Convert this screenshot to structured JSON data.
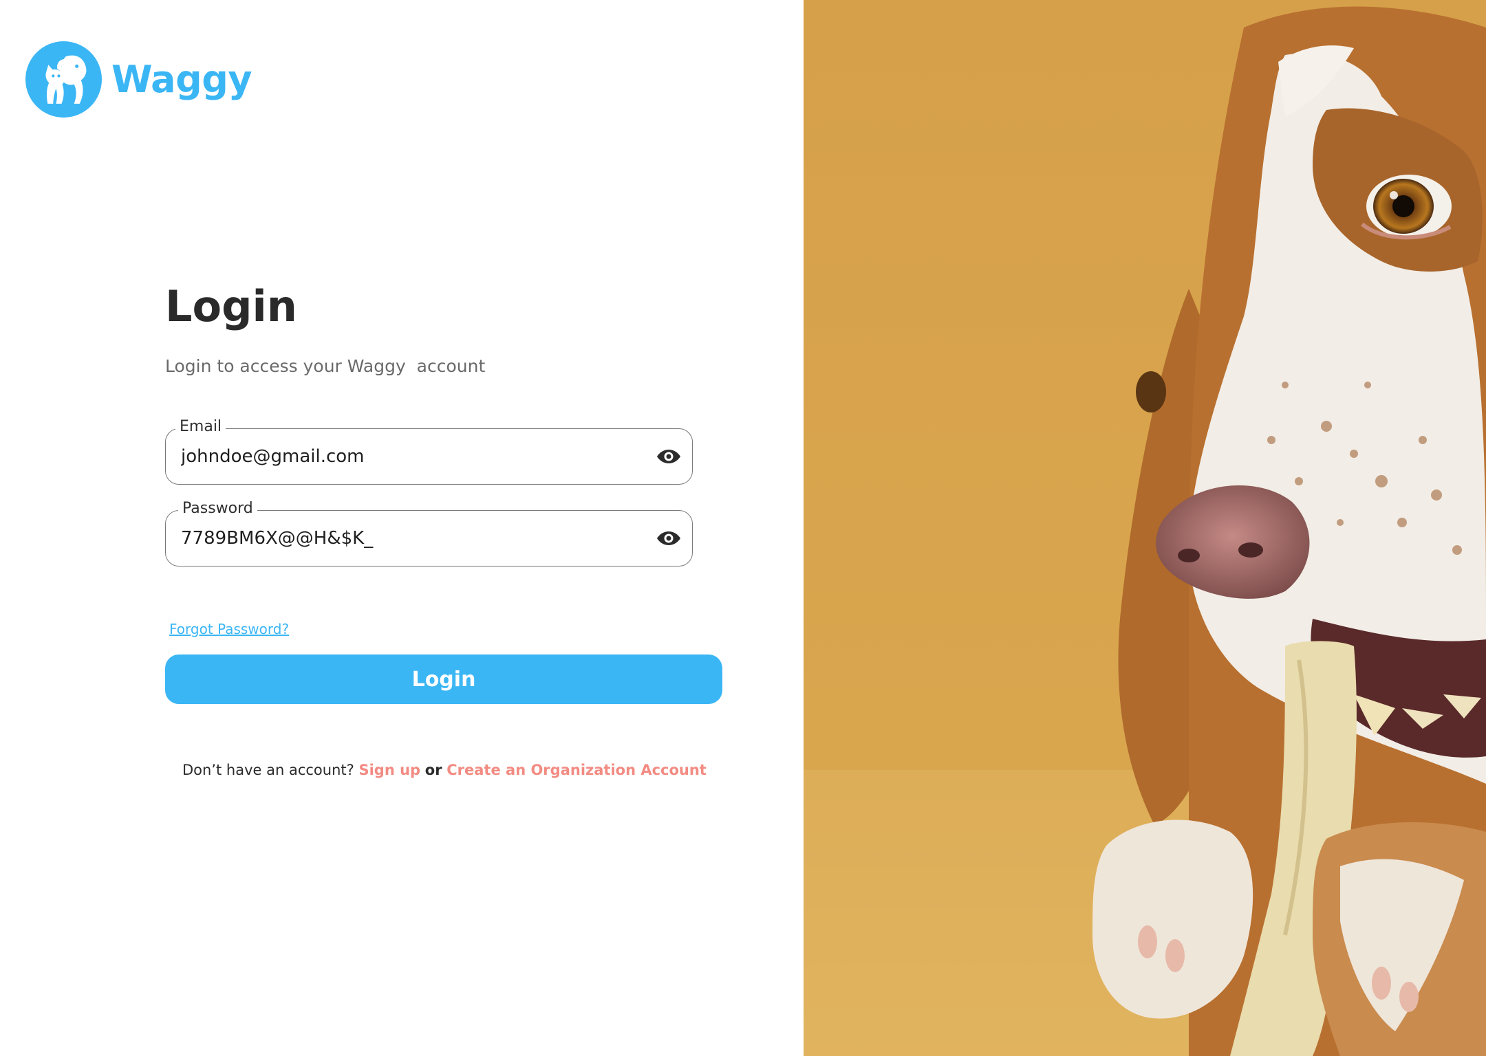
{
  "brand": {
    "name": "Waggy",
    "logo_icon": "dog-and-cat-icon",
    "color": "#3bb6f5"
  },
  "login_form": {
    "title": "Login",
    "subtitle": "Login to access your Waggy  account",
    "email": {
      "label": "Email",
      "value": "johndoe@gmail.com",
      "toggle_icon": "eye-icon"
    },
    "password": {
      "label": "Password",
      "value": "7789BM6X@@H&$K_",
      "toggle_icon": "eye-icon"
    },
    "forgot_password": "Forgot Password?",
    "submit_label": "Login"
  },
  "footer": {
    "prompt": "Don’t have an account?",
    "signup_link": "Sign up",
    "or_text": "or",
    "org_link": "Create an Organization Account",
    "link_color": "#f28b82"
  },
  "hero_image": {
    "subject": "dog-chewing-bone-photo",
    "background_color": "#d9a34a"
  }
}
